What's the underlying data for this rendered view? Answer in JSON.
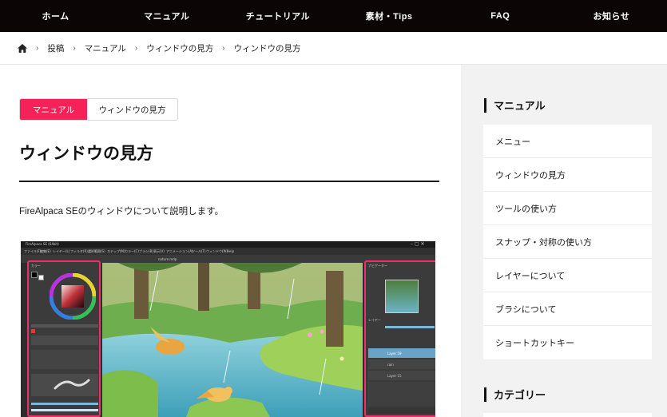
{
  "nav": {
    "items": [
      "ホーム",
      "マニュアル",
      "チュートリアル",
      "素材・Tips",
      "FAQ",
      "お知らせ"
    ]
  },
  "breadcrumb": {
    "items": [
      "投稿",
      "マニュアル",
      "ウィンドウの見方",
      "ウィンドウの見方"
    ]
  },
  "tags": {
    "primary": "マニュアル",
    "secondary": "ウィンドウの見方"
  },
  "article": {
    "title": "ウィンドウの見方",
    "intro": "FireAlpaca SEのウィンドウについて説明します。"
  },
  "sidebar": {
    "heading": "マニュアル",
    "items": [
      "メニュー",
      "ウィンドウの見方",
      "ツールの使い方",
      "スナップ・対称の使い方",
      "レイヤーについて",
      "ブラシについて",
      "ショートカットキー"
    ],
    "heading2": "カテゴリー"
  },
  "app": {
    "window_title": "FireAlpaca SE (64bit)",
    "menu": [
      "ファイル(F)",
      "編集(E)",
      "レイヤー(L)",
      "フィルタ(R)",
      "選択範囲(S)",
      "ステップ(M)",
      "カラー(C)",
      "ブラシ(B)",
      "表示(V)",
      "アニメーション(A)",
      "ツール(T)",
      "ウィンドウ(W)",
      "Help"
    ],
    "panel_color": "カラー",
    "panel_navigator": "ナビゲーター",
    "panel_layer": "レイヤー",
    "layers": [
      "Layer 59",
      "rain",
      "Layer 15"
    ],
    "doc_tab": "nature.mdp"
  },
  "colors": {
    "accent": "#f7215a",
    "nav_bg": "#0b0506",
    "highlight_border": "#ef2f6b"
  }
}
